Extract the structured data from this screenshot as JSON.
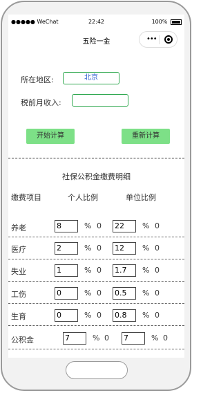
{
  "status_bar": {
    "signal": "●●●●● WeChat",
    "time": "22:42",
    "battery": "100%"
  },
  "nav": {
    "title": "五险一金",
    "capsule_dots": "•••"
  },
  "form": {
    "region_label": "所在地区:",
    "region_value": "北京",
    "income_label": "税前月收入:",
    "income_value": ""
  },
  "buttons": {
    "calculate": "开始计算",
    "recalculate": "重新计算"
  },
  "details": {
    "title": "社保公积金缴费明细",
    "headers": [
      "缴费项目",
      "个人比例",
      "单位比例"
    ],
    "rows": [
      {
        "name": "养老",
        "personal_rate": "8",
        "personal_amount": "0",
        "company_rate": "22",
        "company_amount": "0"
      },
      {
        "name": "医疗",
        "personal_rate": "2",
        "personal_amount": "0",
        "company_rate": "12",
        "company_amount": "0"
      },
      {
        "name": "失业",
        "personal_rate": "1",
        "personal_amount": "0",
        "company_rate": "1.7",
        "company_amount": "0"
      },
      {
        "name": "工伤",
        "personal_rate": "0",
        "personal_amount": "0",
        "company_rate": "0.5",
        "company_amount": "0"
      },
      {
        "name": "生育",
        "personal_rate": "0",
        "personal_amount": "0",
        "company_rate": "0.8",
        "company_amount": "0"
      },
      {
        "name": "公积金",
        "personal_rate": "7",
        "personal_amount": "0",
        "company_rate": "7",
        "company_amount": "0"
      }
    ],
    "percent_sign": "%"
  },
  "colors": {
    "input_border": "#2fa84f",
    "button_bg": "#7de087",
    "link_text": "#2f5fd0"
  }
}
